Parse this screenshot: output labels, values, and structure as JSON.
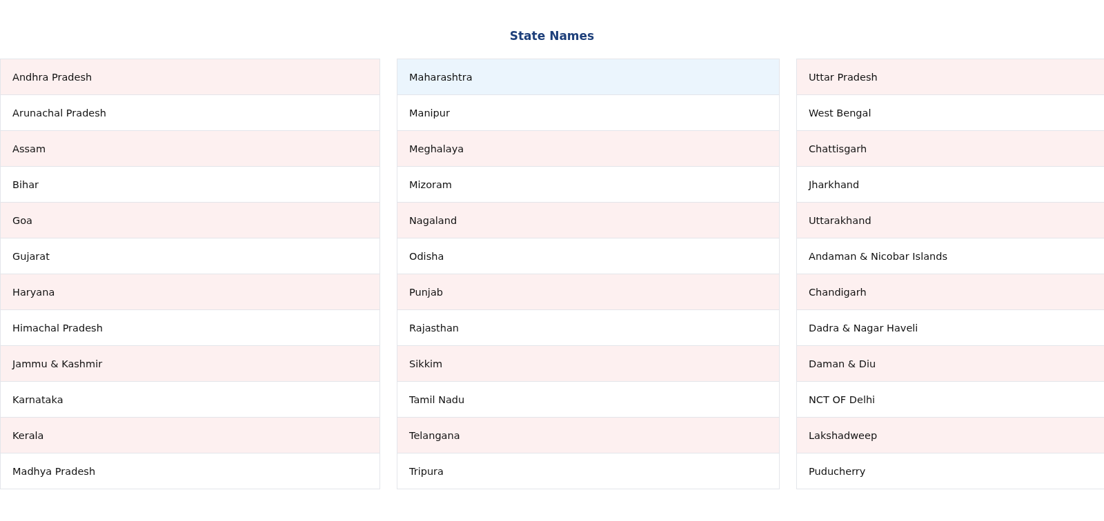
{
  "title": "State Names",
  "columns": [
    {
      "rows": [
        {
          "name": "Andhra Pradesh",
          "highlighted": false
        },
        {
          "name": "Arunachal Pradesh",
          "highlighted": false
        },
        {
          "name": "Assam",
          "highlighted": false
        },
        {
          "name": "Bihar",
          "highlighted": false
        },
        {
          "name": "Goa",
          "highlighted": false
        },
        {
          "name": "Gujarat",
          "highlighted": false
        },
        {
          "name": "Haryana",
          "highlighted": false
        },
        {
          "name": "Himachal Pradesh",
          "highlighted": false
        },
        {
          "name": "Jammu & Kashmir",
          "highlighted": false
        },
        {
          "name": "Karnataka",
          "highlighted": false
        },
        {
          "name": "Kerala",
          "highlighted": false
        },
        {
          "name": "Madhya Pradesh",
          "highlighted": false
        }
      ]
    },
    {
      "rows": [
        {
          "name": "Maharashtra",
          "highlighted": true
        },
        {
          "name": "Manipur",
          "highlighted": false
        },
        {
          "name": "Meghalaya",
          "highlighted": false
        },
        {
          "name": "Mizoram",
          "highlighted": false
        },
        {
          "name": "Nagaland",
          "highlighted": false
        },
        {
          "name": "Odisha",
          "highlighted": false
        },
        {
          "name": "Punjab",
          "highlighted": false
        },
        {
          "name": "Rajasthan",
          "highlighted": false
        },
        {
          "name": "Sikkim",
          "highlighted": false
        },
        {
          "name": "Tamil Nadu",
          "highlighted": false
        },
        {
          "name": "Telangana",
          "highlighted": false
        },
        {
          "name": "Tripura",
          "highlighted": false
        }
      ]
    },
    {
      "rows": [
        {
          "name": "Uttar Pradesh",
          "highlighted": false
        },
        {
          "name": "West Bengal",
          "highlighted": false
        },
        {
          "name": "Chattisgarh",
          "highlighted": false
        },
        {
          "name": "Jharkhand",
          "highlighted": false
        },
        {
          "name": "Uttarakhand",
          "highlighted": false
        },
        {
          "name": "Andaman & Nicobar Islands",
          "highlighted": false
        },
        {
          "name": "Chandigarh",
          "highlighted": false
        },
        {
          "name": "Dadra & Nagar Haveli",
          "highlighted": false
        },
        {
          "name": "Daman & Diu",
          "highlighted": false
        },
        {
          "name": "NCT OF Delhi",
          "highlighted": false
        },
        {
          "name": "Lakshadweep",
          "highlighted": false
        },
        {
          "name": "Puducherry",
          "highlighted": false
        }
      ]
    }
  ]
}
